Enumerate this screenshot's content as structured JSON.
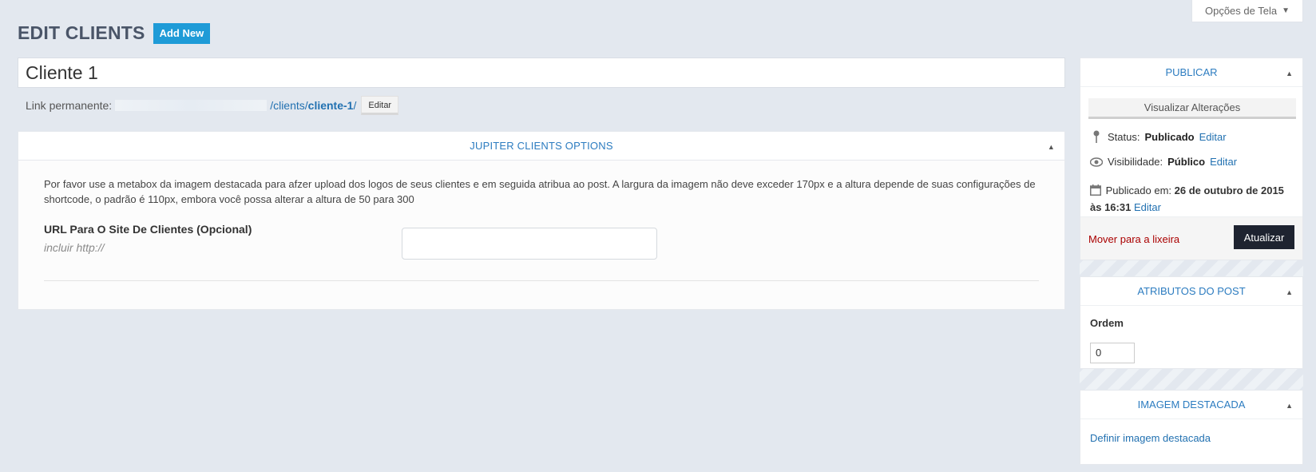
{
  "screen_options": {
    "label": "Opções de Tela"
  },
  "header": {
    "title": "EDIT CLIENTS",
    "add_new": "Add New"
  },
  "post": {
    "title": "Cliente 1",
    "permalink_label": "Link permanente:",
    "permalink_base": "/clients/",
    "permalink_slug": "cliente-1",
    "permalink_trailing": "/",
    "permalink_edit": "Editar"
  },
  "jupiter_box": {
    "title": "JUPITER CLIENTS OPTIONS",
    "description": "Por favor use a metabox da imagem destacada para afzer upload dos logos de seus clientes e em seguida atribua ao post. A largura da imagem não deve exceder 170px e a altura depende de suas configurações de shortcode, o padrão é 110px, embora você possa alterar a altura de 50 para 300",
    "url_label": "URL Para O Site De Clientes (Opcional)",
    "url_hint": "incluir http://",
    "url_value": ""
  },
  "publish": {
    "title": "PUBLICAR",
    "preview": "Visualizar Alterações",
    "status_label": "Status:",
    "status_value": "Publicado",
    "status_edit": "Editar",
    "visibility_label": "Visibilidade:",
    "visibility_value": "Público",
    "visibility_edit": "Editar",
    "published_label": "Publicado em:",
    "published_value": "26 de outubro de 2015 às 16:31",
    "published_edit": "Editar",
    "trash": "Mover para a lixeira",
    "update": "Atualizar"
  },
  "attributes": {
    "title": "ATRIBUTOS DO POST",
    "order_label": "Ordem",
    "order_value": "0"
  },
  "featured": {
    "title": "IMAGEM DESTACADA",
    "set_link": "Definir imagem destacada"
  },
  "colors": {
    "accent": "#2c7cc0",
    "add_new_bg": "#1e9bd7",
    "update_bg": "#1e2330",
    "trash": "#aa0000",
    "background": "#e3e8ef"
  },
  "icons": {
    "toggle": "triangle-up-icon",
    "status": "pin-icon",
    "visibility": "eye-icon",
    "date": "calendar-icon",
    "screen_options": "caret-down-icon"
  }
}
